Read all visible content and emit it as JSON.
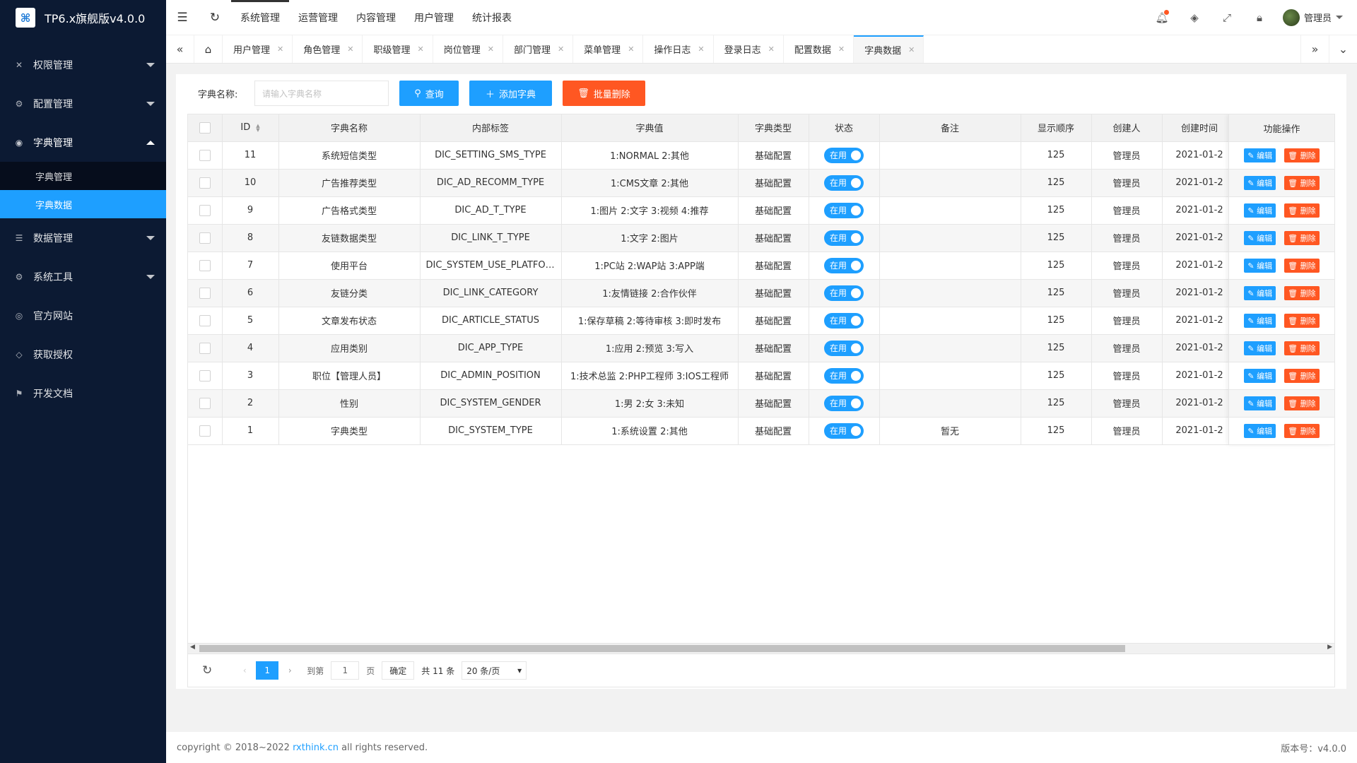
{
  "app": {
    "title": "TP6.x旗舰版v4.0.0",
    "logo_glyph": "⌘"
  },
  "sidebar": {
    "items": [
      {
        "label": "权限管理",
        "icon": "permission-icon",
        "glyph": "✕",
        "caret": "down"
      },
      {
        "label": "配置管理",
        "icon": "gear-icon",
        "glyph": "⚙",
        "caret": "down"
      },
      {
        "label": "字典管理",
        "icon": "globe-icon",
        "glyph": "◉",
        "caret": "up",
        "children": [
          {
            "label": "字典管理"
          },
          {
            "label": "字典数据",
            "active": true
          }
        ]
      },
      {
        "label": "数据管理",
        "icon": "book-icon",
        "glyph": "☰",
        "caret": "down"
      },
      {
        "label": "系统工具",
        "icon": "gear-icon",
        "glyph": "⚙",
        "caret": "down"
      },
      {
        "label": "官方网站",
        "icon": "globe-icon",
        "glyph": "◎"
      },
      {
        "label": "获取授权",
        "icon": "diamond-icon",
        "glyph": "◇"
      },
      {
        "label": "开发文档",
        "icon": "flag-icon",
        "glyph": "⚑"
      }
    ]
  },
  "topnav": {
    "items": [
      "系统管理",
      "运营管理",
      "内容管理",
      "用户管理",
      "统计报表"
    ],
    "user": "管理员"
  },
  "tabs": [
    "用户管理",
    "角色管理",
    "职级管理",
    "岗位管理",
    "部门管理",
    "菜单管理",
    "操作日志",
    "登录日志",
    "配置数据",
    "字典数据"
  ],
  "search": {
    "label": "字典名称:",
    "placeholder": "请输入字典名称",
    "query_btn": "查询",
    "add_btn": "添加字典",
    "batch_delete_btn": "批量删除"
  },
  "table": {
    "headers": [
      "ID",
      "字典名称",
      "内部标签",
      "字典值",
      "字典类型",
      "状态",
      "备注",
      "显示顺序",
      "创建人",
      "创建时间",
      "功能操作"
    ],
    "status_label": "在用",
    "edit_label": "编辑",
    "delete_label": "删除",
    "rows": [
      {
        "id": "11",
        "name": "系统短信类型",
        "code": "DIC_SETTING_SMS_TYPE",
        "value": "1:NORMAL 2:其他",
        "type": "基础配置",
        "note": "",
        "sort": "125",
        "creator": "管理员",
        "created": "2021-01-2"
      },
      {
        "id": "10",
        "name": "广告推荐类型",
        "code": "DIC_AD_RECOMM_TYPE",
        "value": "1:CMS文章 2:其他",
        "type": "基础配置",
        "note": "",
        "sort": "125",
        "creator": "管理员",
        "created": "2021-01-2"
      },
      {
        "id": "9",
        "name": "广告格式类型",
        "code": "DIC_AD_T_TYPE",
        "value": "1:图片 2:文字 3:视频 4:推荐",
        "type": "基础配置",
        "note": "",
        "sort": "125",
        "creator": "管理员",
        "created": "2021-01-2"
      },
      {
        "id": "8",
        "name": "友链数据类型",
        "code": "DIC_LINK_T_TYPE",
        "value": "1:文字 2:图片",
        "type": "基础配置",
        "note": "",
        "sort": "125",
        "creator": "管理员",
        "created": "2021-01-2"
      },
      {
        "id": "7",
        "name": "使用平台",
        "code": "DIC_SYSTEM_USE_PLATFORM",
        "value": "1:PC站 2:WAP站 3:APP端",
        "type": "基础配置",
        "note": "",
        "sort": "125",
        "creator": "管理员",
        "created": "2021-01-2"
      },
      {
        "id": "6",
        "name": "友链分类",
        "code": "DIC_LINK_CATEGORY",
        "value": "1:友情链接 2:合作伙伴",
        "type": "基础配置",
        "note": "",
        "sort": "125",
        "creator": "管理员",
        "created": "2021-01-2"
      },
      {
        "id": "5",
        "name": "文章发布状态",
        "code": "DIC_ARTICLE_STATUS",
        "value": "1:保存草稿 2:等待审核 3:即时发布",
        "type": "基础配置",
        "note": "",
        "sort": "125",
        "creator": "管理员",
        "created": "2021-01-2"
      },
      {
        "id": "4",
        "name": "应用类别",
        "code": "DIC_APP_TYPE",
        "value": "1:应用 2:预览 3:写入",
        "type": "基础配置",
        "note": "",
        "sort": "125",
        "creator": "管理员",
        "created": "2021-01-2"
      },
      {
        "id": "3",
        "name": "职位【管理人员】",
        "code": "DIC_ADMIN_POSITION",
        "value": "1:技术总监 2:PHP工程师 3:IOS工程师",
        "type": "基础配置",
        "note": "",
        "sort": "125",
        "creator": "管理员",
        "created": "2021-01-2"
      },
      {
        "id": "2",
        "name": "性别",
        "code": "DIC_SYSTEM_GENDER",
        "value": "1:男 2:女 3:未知",
        "type": "基础配置",
        "note": "",
        "sort": "125",
        "creator": "管理员",
        "created": "2021-01-2"
      },
      {
        "id": "1",
        "name": "字典类型",
        "code": "DIC_SYSTEM_TYPE",
        "value": "1:系统设置 2:其他",
        "type": "基础配置",
        "note": "暂无",
        "sort": "125",
        "creator": "管理员",
        "created": "2021-01-2"
      }
    ]
  },
  "pagination": {
    "current": "1",
    "goto_label": "到第",
    "goto_value": "1",
    "page_label": "页",
    "confirm": "确定",
    "total": "共 11 条",
    "page_size": "20 条/页"
  },
  "footer": {
    "copyright_pre": "copyright © 2018~2022",
    "link": "rxthink.cn",
    "copyright_post": "all rights reserved.",
    "version": "版本号：v4.0.0"
  },
  "colors": {
    "accent": "#1e9fff",
    "danger": "#ff5722",
    "sidebar": "#0c1a33"
  }
}
